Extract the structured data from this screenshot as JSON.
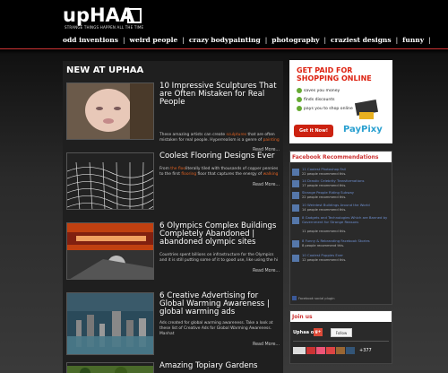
{
  "header": {
    "logo_text": "upHAA",
    "logo_tagline": "STRANGE THINGS HAPPEN ALL THE TIME",
    "nav": [
      "odd inventions",
      "weird people",
      "crazy bodypainting",
      "photography",
      "craziest designs",
      "funny"
    ]
  },
  "main": {
    "title": "NEW AT UPHAA",
    "posts": [
      {
        "title": "10 Impressive Sculptures That are Often Mistaken for Real People",
        "desc_pre": "These amazing artists can create ",
        "desc_hl": "sculptures",
        "desc_post": " that are often mistaken for real people. Hyperrealism is a genre of ",
        "desc_hl2": "painting",
        "desc_end": "",
        "read_more": "Read More..."
      },
      {
        "title": "Coolest Flooring Designs Ever",
        "desc_pre": "From ",
        "desc_hl": "the floo",
        "desc_post": "literally tiled with thousands of copper pennies to the first ",
        "desc_hl2": "flooring",
        "desc_end": " floor that captures the energy of ",
        "desc_hl3": "walking",
        "read_more": "Read More..."
      },
      {
        "title": "6 Olympics Complex Buildings Completely Abandoned | abandoned olympic sites",
        "desc_pre": "Countries spent billions on infrastructure for the Olympics and it is still putting some of it to good use, like using the hi",
        "read_more": "Read More..."
      },
      {
        "title": "6 Creative Advertising for Global Warming Awareness | global warming ads",
        "desc_pre": "Ads created for global warming awareness. Take a look at these list of Creative Ads for Global Warming Awareness. Manhat",
        "read_more": "Read More..."
      },
      {
        "title": "Amazing Topiary Gardens"
      }
    ]
  },
  "ad": {
    "title": "GET PAID FOR SHOPPING ONLINE",
    "items": [
      "saves you money",
      "finds discounts",
      "pays you to shop online"
    ],
    "button": "Get it Now!",
    "brand": "PayPixy"
  },
  "facebook": {
    "title": "Facebook Recommendations",
    "items": [
      {
        "link": "11 Coolest Photoshop Fail",
        "count": "22 people recommend this."
      },
      {
        "link": "14 Drastic Celebrity Transformations",
        "count": "17 people recommend this."
      },
      {
        "link": "Strange People Riding Subway",
        "count": "22 people recommend this."
      },
      {
        "link": "10 Weirdest Buildings Around the World",
        "count": "14 people recommend this."
      },
      {
        "link": "8 Gadgets and Technologies Which are Banned by Government for Strange Reasons",
        "count": "11 people recommend this."
      },
      {
        "link": "8 Funny & Rebranding Facebook Stories",
        "count": "8 people recommend this."
      },
      {
        "link": "10 Coolest Puppies Ever",
        "count": "12 people recommend this."
      }
    ],
    "plugin": "Facebook social plugin"
  },
  "join": {
    "title": "Join us",
    "name": "Uphaa on",
    "gplus": "g+",
    "follow": "Follow",
    "count": "+377"
  },
  "colors": {
    "accent": "#cc3333",
    "link": "#6e8fd0",
    "highlight": "#e06020"
  }
}
